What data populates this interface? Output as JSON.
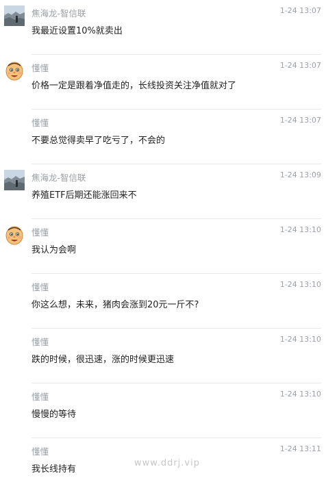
{
  "messages": [
    {
      "sender": "焦海龙-智信联",
      "time": "1-24 13:07",
      "text": "我最近设置10%就卖出",
      "avatar": "landscape"
    },
    {
      "sender": "懂懂",
      "time": "1-24 13:07",
      "text": "价格一定是跟着净值走的，长线投资关注净值就对了",
      "avatar": "cartoon"
    },
    {
      "sender": "懂懂",
      "time": "1-24 13:07",
      "text": "不要总觉得卖早了吃亏了，不会的",
      "avatar": "none"
    },
    {
      "sender": "焦海龙-智信联",
      "time": "1-24 13:09",
      "text": "养殖ETF后期还能涨回来不",
      "avatar": "landscape"
    },
    {
      "sender": "懂懂",
      "time": "1-24 13:10",
      "text": "我认为会啊",
      "avatar": "cartoon"
    },
    {
      "sender": "懂懂",
      "time": "1-24 13:10",
      "text": "你这么想，未来，猪肉会涨到20元一斤不?",
      "avatar": "none"
    },
    {
      "sender": "懂懂",
      "time": "1-24 13:10",
      "text": "跌的时候，很迅速，涨的时候更迅速",
      "avatar": "none"
    },
    {
      "sender": "懂懂",
      "time": "1-24 13:10",
      "text": "慢慢的等待",
      "avatar": "none"
    },
    {
      "sender": "懂懂",
      "time": "1-24 13:11",
      "text": "我长线持有",
      "avatar": "none"
    }
  ],
  "watermark": "www.ddrj.vip"
}
